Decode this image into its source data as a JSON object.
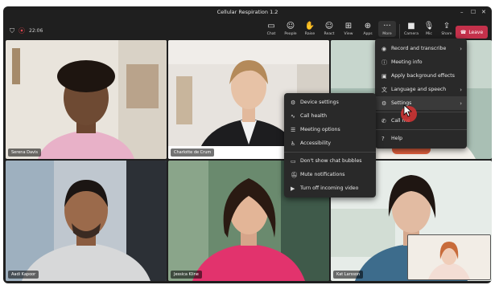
{
  "window": {
    "title": "Cellular Respiration 1.2"
  },
  "status": {
    "timer": "22:06"
  },
  "toolbar": {
    "chat": "Chat",
    "people": "People",
    "raise": "Raise",
    "react": "React",
    "view": "View",
    "apps": "Apps",
    "more": "More",
    "camera": "Camera",
    "mic": "Mic",
    "share": "Share",
    "leave": "Leave"
  },
  "participants": [
    {
      "name": "Serena Davis"
    },
    {
      "name": "Charlotte de Crum"
    },
    {
      "name": "Aadi Kapoor"
    },
    {
      "name": "Jessica Kline"
    },
    {
      "name": "Kat Larsson"
    }
  ],
  "more_menu": {
    "items": [
      "Record and transcribe",
      "Meeting info",
      "Apply background effects",
      "Language and speech",
      "Settings",
      "Call me",
      "Help"
    ]
  },
  "settings_menu": {
    "items": [
      "Device settings",
      "Call health",
      "Meeting options",
      "Accessibility",
      "Don't show chat bubbles",
      "Mute notifications",
      "Turn off incoming video"
    ]
  }
}
